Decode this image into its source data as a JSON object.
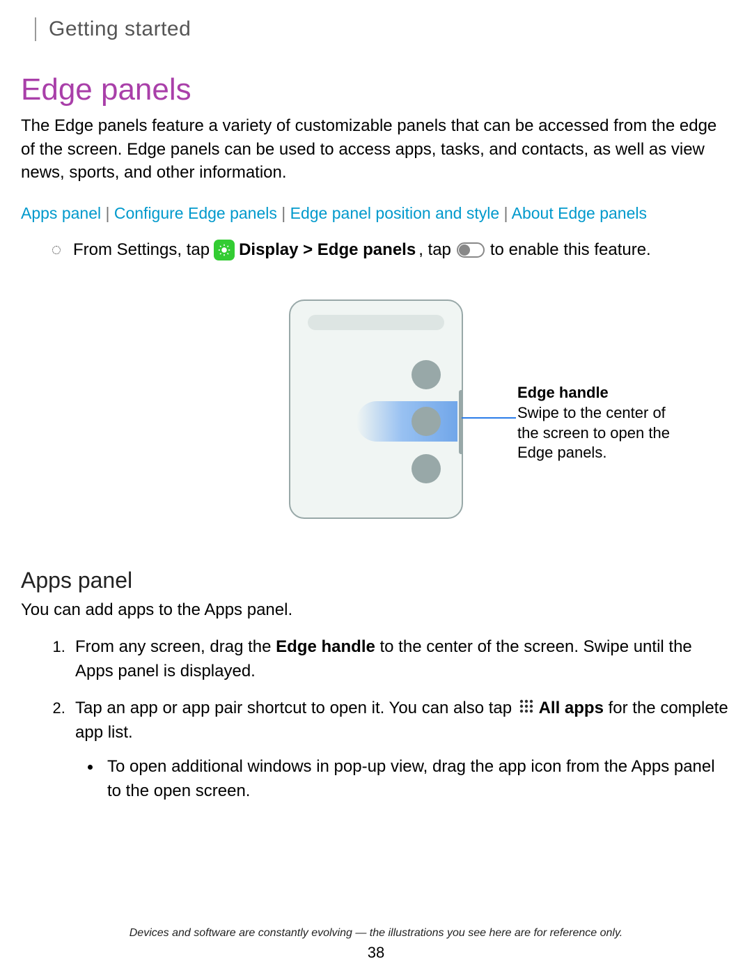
{
  "breadcrumb": "Getting started",
  "title": "Edge panels",
  "intro": "The Edge panels feature a variety of customizable panels that can be accessed from the edge of the screen. Edge panels can be used to access apps, tasks, and contacts, as well as view news, sports, and other information.",
  "links": {
    "l1": "Apps panel",
    "l2": "Configure Edge panels",
    "l3": "Edge panel position and style",
    "l4": "About Edge panels"
  },
  "step": {
    "pre": "From Settings, tap",
    "bold": " Display > Edge panels",
    "mid": ", tap",
    "post": "to enable this feature."
  },
  "callout": {
    "title": "Edge handle",
    "body": "Swipe to the center of the screen to open the Edge panels."
  },
  "section2": {
    "heading": "Apps panel",
    "intro": "You can add apps to the Apps panel.",
    "step1_a": "From any screen, drag the ",
    "step1_b": "Edge handle",
    "step1_c": " to the center of the screen. Swipe until the Apps panel is displayed.",
    "step2_a": "Tap an app or app pair shortcut to open it. You can also tap",
    "step2_b": " All apps",
    "step2_c": " for the complete app list.",
    "sub1": "To open additional windows in pop-up view, drag the app icon from the Apps panel to the open screen."
  },
  "footer": "Devices and software are constantly evolving — the illustrations you see here are for reference only.",
  "page": "38"
}
